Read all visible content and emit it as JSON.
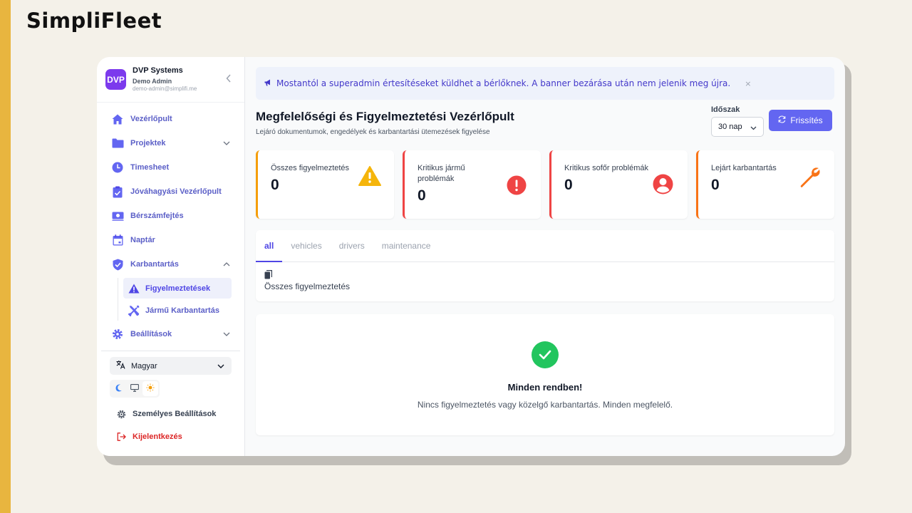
{
  "brand": {
    "title": "SimpliFleet"
  },
  "org": {
    "logo": "DVP",
    "name": "DVP Systems",
    "user": "Demo Admin",
    "email": "demo-admin@simplifi.me",
    "collapse_icon": "chevron-left-icon"
  },
  "sidebar": {
    "items": [
      {
        "label": "Vezérlőpult",
        "icon": "home-icon"
      },
      {
        "label": "Projektek",
        "icon": "folder-icon",
        "expandable": true
      },
      {
        "label": "Timesheet",
        "icon": "clock-icon"
      },
      {
        "label": "Jóváhagyási Vezérlőpult",
        "icon": "clipboard-check-icon"
      },
      {
        "label": "Bérszámfejtés",
        "icon": "money-icon"
      },
      {
        "label": "Naptár",
        "icon": "calendar-icon"
      },
      {
        "label": "Karbantartás",
        "icon": "shield-check-icon",
        "expanded": true
      },
      {
        "label": "Beállítások",
        "icon": "gear-icon",
        "expandable": true
      }
    ],
    "sub_items": [
      {
        "label": "Figyelmeztetések",
        "icon": "warning-icon",
        "active": true
      },
      {
        "label": "Jármű Karbantartás",
        "icon": "tools-icon"
      }
    ],
    "language": "Magyar",
    "theme_options": [
      "moon-icon",
      "monitor-icon",
      "sun-icon"
    ],
    "active_theme": "sun-icon",
    "personal_settings": "Személyes Beállítások",
    "logout": "Kijelentkezés"
  },
  "banner": {
    "text": "Mostantól a superadmin értesítéseket küldhet a bérlőknek. A banner bezárása után nem jelenik meg újra.",
    "close": "×"
  },
  "header": {
    "title": "Megfelelőségi és Figyelmeztetési Vezérlőpult",
    "subtitle": "Lejáró dokumentumok, engedélyek és karbantartási ütemezések figyelése",
    "period_label": "Időszak",
    "period_value": "30 nap",
    "refresh_label": "Frissítés"
  },
  "cards": [
    {
      "label": "Összes figyelmeztetés",
      "value": "0",
      "icon": "warning-triangle-icon",
      "color": "#f59e0b"
    },
    {
      "label": "Kritikus jármű problémák",
      "value": "0",
      "icon": "alert-circle-icon",
      "color": "#ef4444"
    },
    {
      "label": "Kritikus sofőr problémák",
      "value": "0",
      "icon": "user-circle-icon",
      "color": "#ef4444"
    },
    {
      "label": "Lejárt karbantartás",
      "value": "0",
      "icon": "wrench-icon",
      "color": "#f97316"
    }
  ],
  "tabs": [
    {
      "label": "all",
      "active": true
    },
    {
      "label": "vehicles"
    },
    {
      "label": "drivers"
    },
    {
      "label": "maintenance"
    }
  ],
  "tab_content": {
    "icon": "copy-icon",
    "label": "Összes figyelmeztetés"
  },
  "empty_state": {
    "icon": "check-circle-icon",
    "title": "Minden rendben!",
    "subtitle": "Nincs figyelmeztetés vagy közelgő karbantartás. Minden megfelelő."
  },
  "colors": {
    "accent": "#6366f1",
    "sidebar_text": "#5b5fc7",
    "success": "#22c55e"
  }
}
